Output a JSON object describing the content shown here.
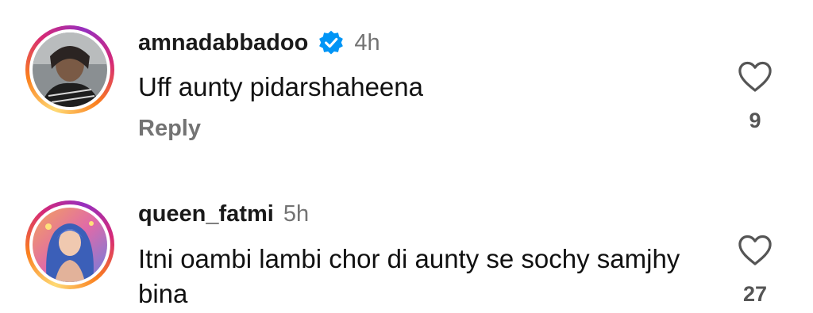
{
  "comments": [
    {
      "username": "amnadabbadoo",
      "verified": true,
      "time": "4h",
      "text": "Uff aunty pidarshaheena",
      "reply_label": "Reply",
      "likes": "9",
      "avatar_icon": "avatar-photo"
    },
    {
      "username": "queen_fatmi",
      "verified": false,
      "time": "5h",
      "text": "Itni oambi lambi chor di aunty se sochy samjhy bina",
      "likes": "27",
      "avatar_icon": "avatar-photo"
    }
  ],
  "colors": {
    "verified_badge": "#0095f6",
    "secondary_text": "#737373",
    "ring_start": "#feda75",
    "ring_end": "#962fbf"
  }
}
